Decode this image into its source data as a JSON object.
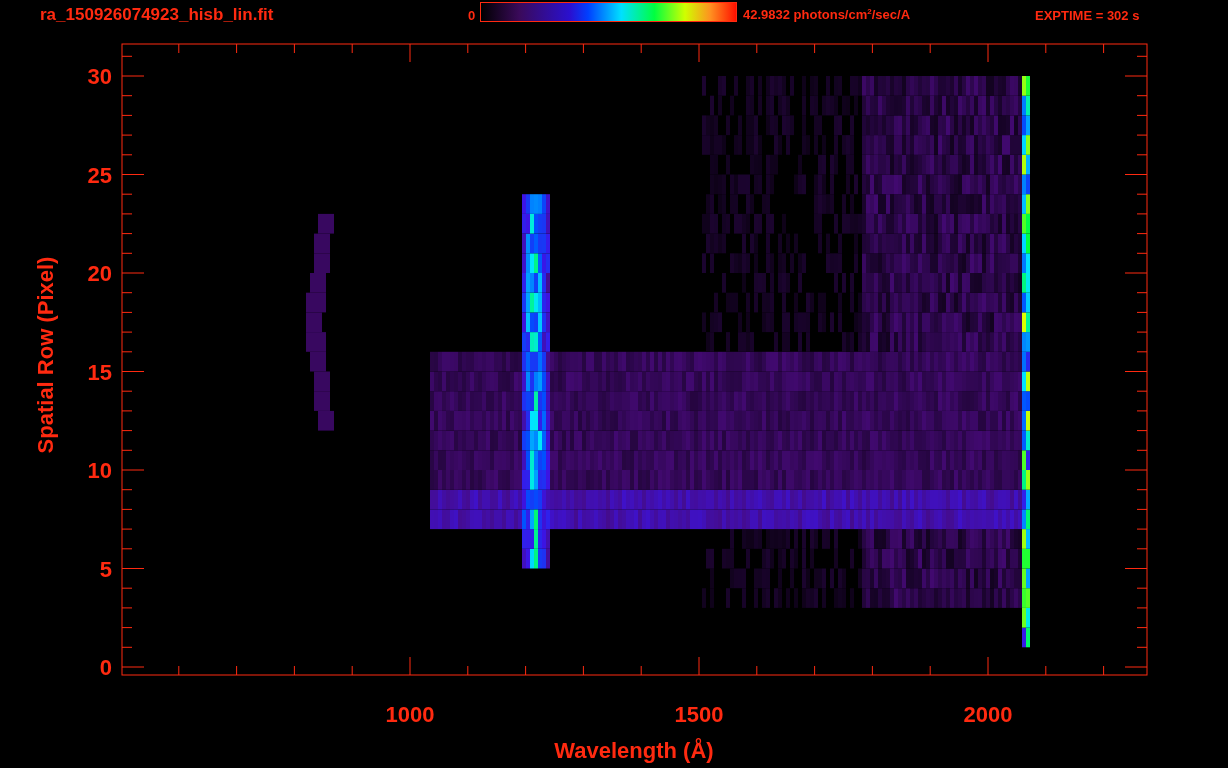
{
  "header": {
    "title": "ra_150926074923_hisb_lin.fit",
    "colorbar": {
      "min_label": "0",
      "max_label": "42.9832 photons/cm$^{2}$/sec/A"
    },
    "exposure": "EXPTIME = 302 s"
  },
  "y_axis": {
    "label": "Spatial Row (Pixel)",
    "ticks": [
      "30",
      "25",
      "20",
      "15",
      "10",
      "5",
      "0"
    ]
  },
  "x_axis": {
    "label": "Wavelength (Å)",
    "ticks": [
      "1000",
      "1500",
      "2000"
    ]
  }
}
